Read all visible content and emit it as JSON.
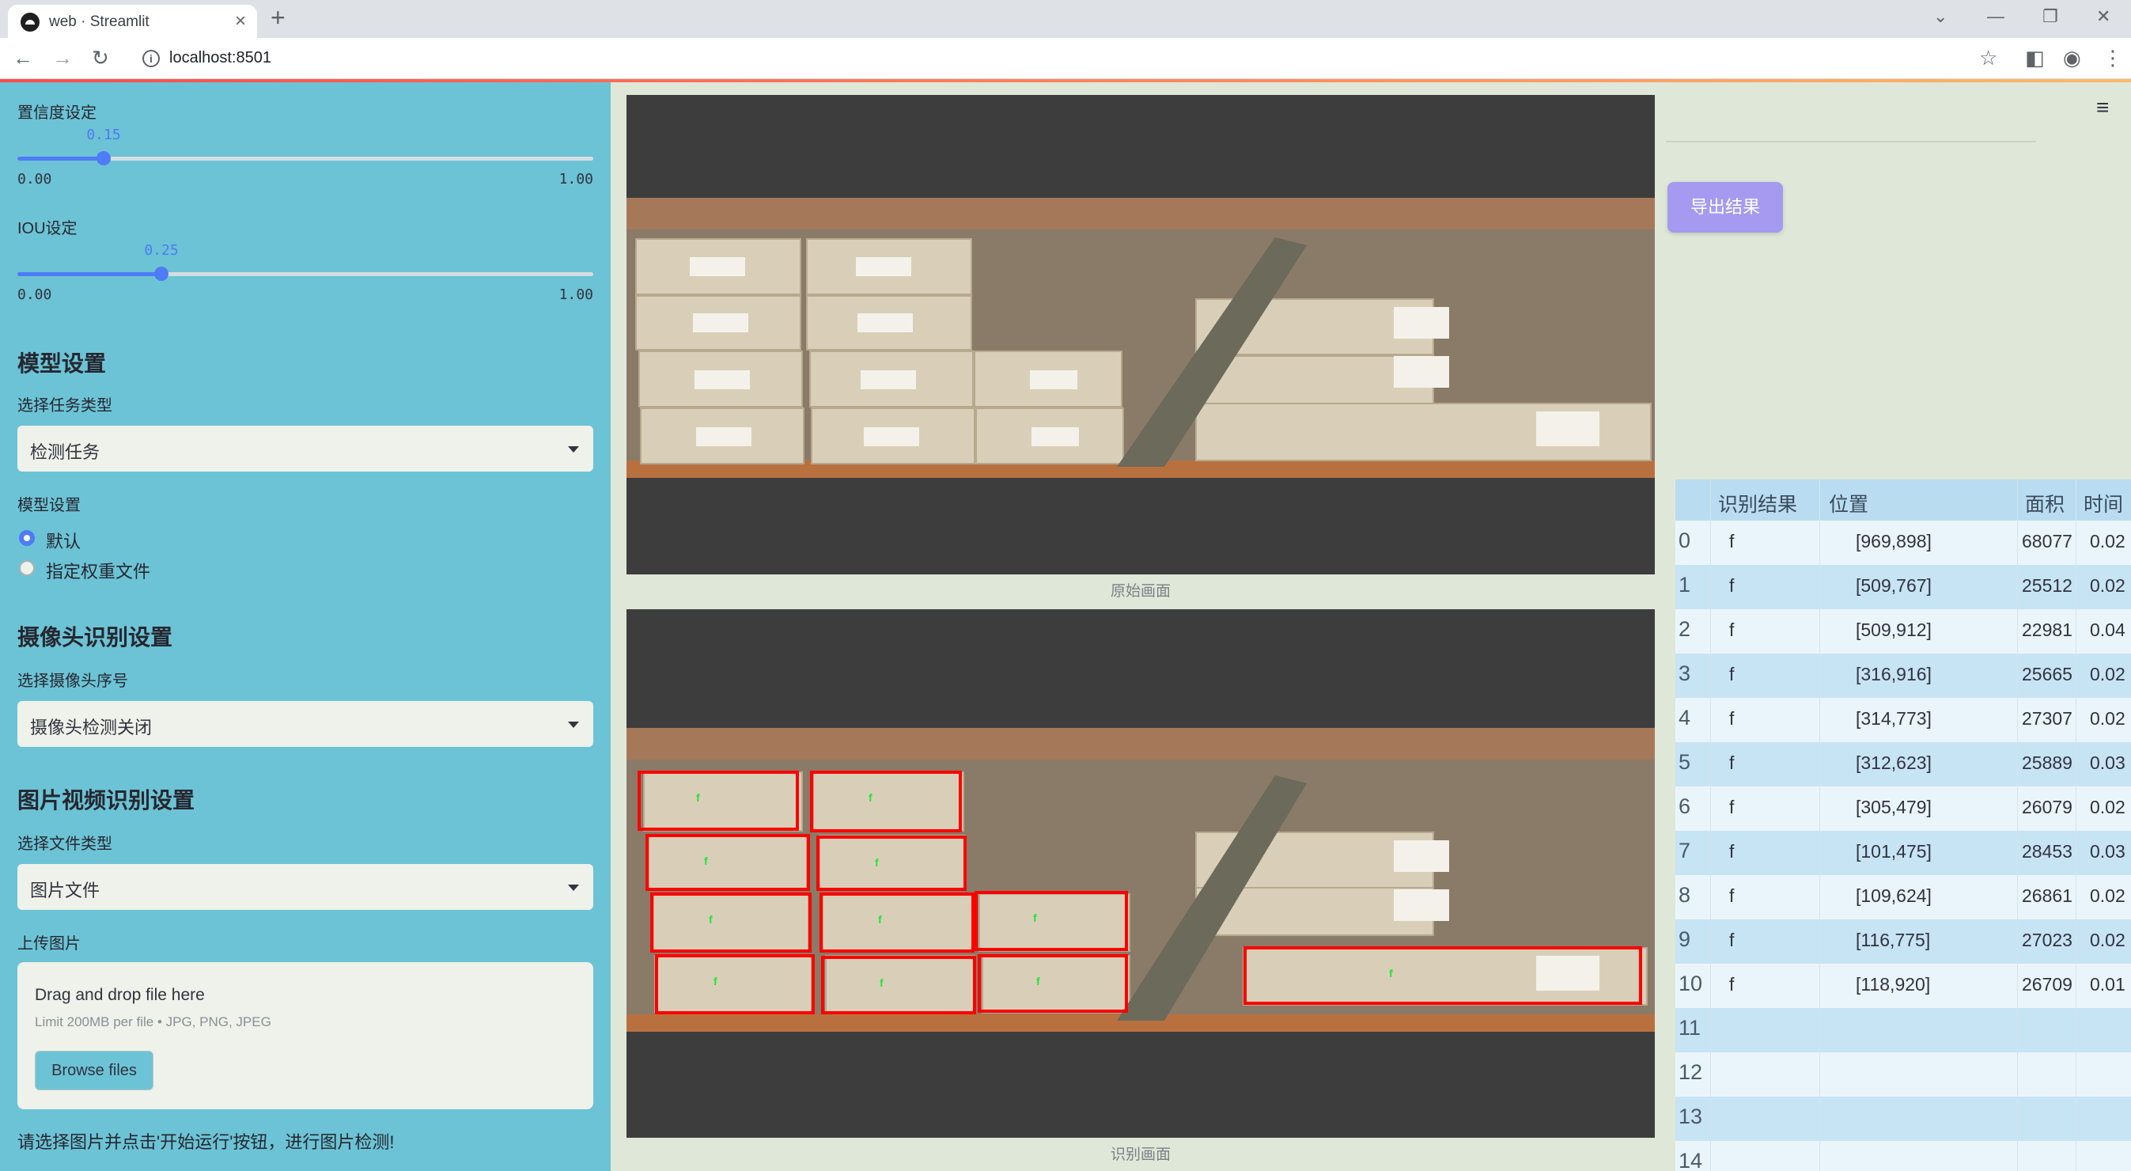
{
  "browser": {
    "tab_title": "web · Streamlit",
    "url": "localhost:8501"
  },
  "sidebar": {
    "confidence_label": "置信度设定",
    "confidence": {
      "value": "0.15",
      "min": "0.00",
      "max": "1.00",
      "fraction": 0.15
    },
    "iou_label": "IOU设定",
    "iou": {
      "value": "0.25",
      "min": "0.00",
      "max": "1.00",
      "fraction": 0.25
    },
    "model_header": "模型设置",
    "task_type_label": "选择任务类型",
    "task_type_value": "检测任务",
    "model_settings_label": "模型设置",
    "model_options": [
      "默认",
      "指定权重文件"
    ],
    "model_selected": "默认",
    "camera_header": "摄像头识别设置",
    "camera_select_label": "选择摄像头序号",
    "camera_select_value": "摄像头检测关闭",
    "media_header": "图片视频识别设置",
    "file_type_label": "选择文件类型",
    "file_type_value": "图片文件",
    "upload_label": "上传图片",
    "upload_drag_text": "Drag and drop file here",
    "upload_limit_text": "Limit 200MB per file • JPG, PNG, JPEG",
    "browse_button": "Browse files",
    "hint_text": "请选择图片并点击'开始运行'按钮，进行图片检测!"
  },
  "main": {
    "original_caption": "原始画面",
    "result_caption": "识别画面"
  },
  "right": {
    "export_button": "导出结果"
  },
  "table": {
    "headers": [
      "识别结果",
      "位置",
      "面积",
      "时间"
    ],
    "rows": [
      {
        "index": "0",
        "result": "f",
        "position": "[969,898]",
        "area": "68077",
        "time": "0.02"
      },
      {
        "index": "1",
        "result": "f",
        "position": "[509,767]",
        "area": "25512",
        "time": "0.02"
      },
      {
        "index": "2",
        "result": "f",
        "position": "[509,912]",
        "area": "22981",
        "time": "0.04"
      },
      {
        "index": "3",
        "result": "f",
        "position": "[316,916]",
        "area": "25665",
        "time": "0.02"
      },
      {
        "index": "4",
        "result": "f",
        "position": "[314,773]",
        "area": "27307",
        "time": "0.02"
      },
      {
        "index": "5",
        "result": "f",
        "position": "[312,623]",
        "area": "25889",
        "time": "0.03"
      },
      {
        "index": "6",
        "result": "f",
        "position": "[305,479]",
        "area": "26079",
        "time": "0.02"
      },
      {
        "index": "7",
        "result": "f",
        "position": "[101,475]",
        "area": "28453",
        "time": "0.03"
      },
      {
        "index": "8",
        "result": "f",
        "position": "[109,624]",
        "area": "26861",
        "time": "0.02"
      },
      {
        "index": "9",
        "result": "f",
        "position": "[116,775]",
        "area": "27023",
        "time": "0.02"
      },
      {
        "index": "10",
        "result": "f",
        "position": "[118,920]",
        "area": "26709",
        "time": "0.01"
      },
      {
        "index": "11",
        "result": "",
        "position": "",
        "area": "",
        "time": ""
      },
      {
        "index": "12",
        "result": "",
        "position": "",
        "area": "",
        "time": ""
      },
      {
        "index": "13",
        "result": "",
        "position": "",
        "area": "",
        "time": ""
      },
      {
        "index": "14",
        "result": "",
        "position": "",
        "area": "",
        "time": ""
      }
    ]
  },
  "detection_label": "f",
  "colors": {
    "sidebar_bg": "#6cc3d5",
    "accent": "#4e7bf6",
    "export_button": "#a59af0",
    "detection_box": "#ff0000"
  }
}
